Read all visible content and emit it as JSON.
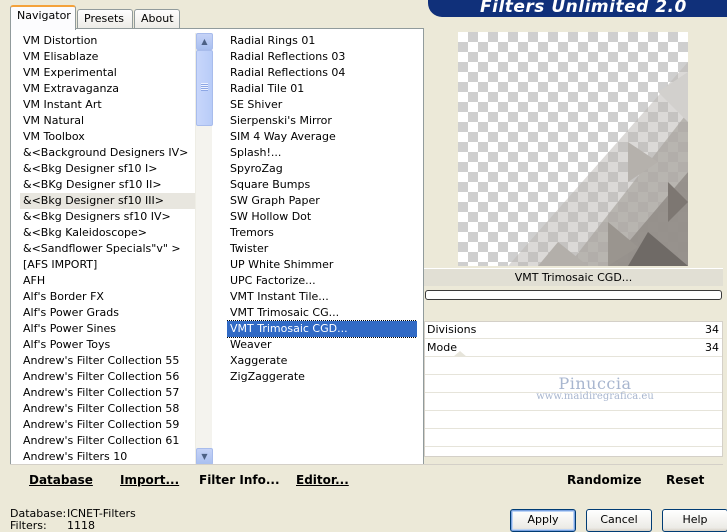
{
  "tabs": [
    "Navigator",
    "Presets",
    "About"
  ],
  "app_title": "Filters Unlimited 2.0",
  "categories": [
    "VM Distortion",
    "VM Elisablaze",
    "VM Experimental",
    "VM Extravaganza",
    "VM Instant Art",
    "VM Natural",
    "VM Toolbox",
    "&<Background Designers IV>",
    "&<Bkg Designer sf10 I>",
    "&<BKg Designer sf10 II>",
    "&<Bkg Designer sf10 III>",
    "&<Bkg Designers sf10 IV>",
    "&<Bkg Kaleidoscope>",
    "&<Sandflower Specials\"v\" >",
    "[AFS IMPORT]",
    "AFH",
    "Alf's Border FX",
    "Alf's Power Grads",
    "Alf's Power Sines",
    "Alf's Power Toys",
    "Andrew's Filter Collection 55",
    "Andrew's Filter Collection 56",
    "Andrew's Filter Collection 57",
    "Andrew's Filter Collection 58",
    "Andrew's Filter Collection 59",
    "Andrew's Filter Collection 61",
    "Andrew's Filters 10"
  ],
  "selected_category": "&<Bkg Designer sf10 III>",
  "filters": [
    "Radial  Rings 01",
    "Radial Reflections 03",
    "Radial Reflections 04",
    "Radial Tile 01",
    "SE Shiver",
    "Sierpenski's Mirror",
    "SIM 4 Way Average",
    "Splash!...",
    "SpyroZag",
    "Square Bumps",
    "SW Graph Paper",
    "SW Hollow Dot",
    "Tremors",
    "Twister",
    "UP White Shimmer",
    "UPC Factorize...",
    "VMT Instant Tile...",
    "VMT Trimosaic CG...",
    "VMT Trimosaic CGD...",
    "Weaver",
    "Xaggerate",
    "ZigZaggerate"
  ],
  "selected_filter": "VMT Trimosaic CGD...",
  "bottom_buttons": {
    "database": "Database",
    "import": "Import...",
    "filter_info": "Filter Info...",
    "editor": "Editor..."
  },
  "preview_label": "VMT Trimosaic CGD...",
  "progress": 0,
  "params": [
    {
      "name": "Divisions",
      "value": "34"
    },
    {
      "name": "Mode",
      "value": "34"
    }
  ],
  "watermark": {
    "line1": "Pinuccia",
    "line2": "www.maidiregrafica.eu"
  },
  "right_buttons": {
    "randomize": "Randomize",
    "reset": "Reset"
  },
  "status": {
    "database_label": "Database:",
    "database_value": "ICNET-Filters",
    "filters_label": "Filters:",
    "filters_value": "1118"
  },
  "dialog_buttons": {
    "apply": "Apply",
    "cancel": "Cancel",
    "help": "Help"
  },
  "colors": {
    "accent": "#316ac5",
    "banner": "#10307a",
    "tab_highlight": "#f4a23a"
  },
  "icons": {
    "scroll_up": "scroll-up-icon",
    "scroll_down": "scroll-down-icon"
  }
}
